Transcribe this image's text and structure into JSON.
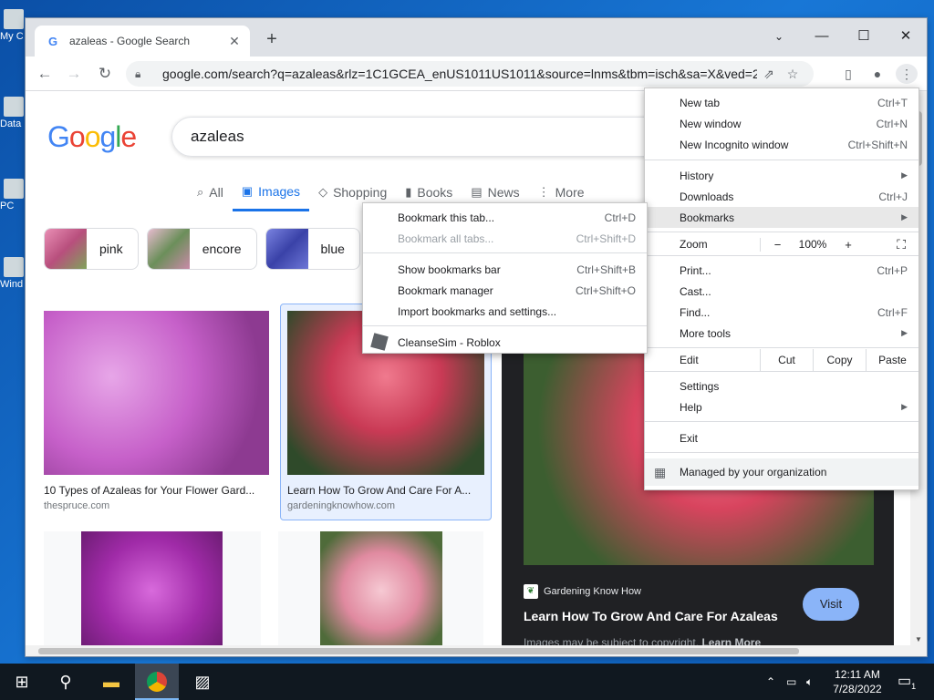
{
  "desktop": {
    "icons": [
      {
        "label": "My C"
      },
      {
        "label": "Data"
      },
      {
        "label": "PC"
      },
      {
        "label": "Wind"
      }
    ]
  },
  "browser": {
    "tab_title": "azaleas - Google Search",
    "tab_favicon": "G",
    "url": "google.com/search?q=azaleas&rlz=1C1GCEA_enUS1011US1011&source=lnms&tbm=isch&sa=X&ved=2a..."
  },
  "page": {
    "logo": "Google",
    "search_query": "azaleas",
    "tabs": [
      {
        "label": "All",
        "icon": "search-icon"
      },
      {
        "label": "Images",
        "icon": "image-icon"
      },
      {
        "label": "Shopping",
        "icon": "tag-icon"
      },
      {
        "label": "Books",
        "icon": "book-icon"
      },
      {
        "label": "News",
        "icon": "news-icon"
      },
      {
        "label": "More",
        "icon": "more-icon"
      }
    ],
    "chips": [
      {
        "label": "pink",
        "color": "#d86a9a"
      },
      {
        "label": "encore",
        "color": "#c98aa8"
      },
      {
        "label": "blue",
        "color": "#5a63c7"
      }
    ],
    "results": [
      {
        "caption": "10 Types of Azaleas for Your Flower Gard...",
        "site": "thespruce.com"
      },
      {
        "caption": "Learn How To Grow And Care For A...",
        "site": "gardeningknowhow.com"
      }
    ],
    "preview": {
      "source": "Gardening Know How",
      "title": "Learn How To Grow And Care For Azaleas",
      "visit": "Visit",
      "copyright": "Images may be subject to copyright.",
      "learn_more": "Learn More"
    }
  },
  "chrome_menu": {
    "new_tab": {
      "label": "New tab",
      "shortcut": "Ctrl+T"
    },
    "new_window": {
      "label": "New window",
      "shortcut": "Ctrl+N"
    },
    "incognito": {
      "label": "New Incognito window",
      "shortcut": "Ctrl+Shift+N"
    },
    "history": {
      "label": "History"
    },
    "downloads": {
      "label": "Downloads",
      "shortcut": "Ctrl+J"
    },
    "bookmarks": {
      "label": "Bookmarks"
    },
    "zoom": {
      "label": "Zoom",
      "minus": "−",
      "value": "100%",
      "plus": "+"
    },
    "print": {
      "label": "Print...",
      "shortcut": "Ctrl+P"
    },
    "cast": {
      "label": "Cast..."
    },
    "find": {
      "label": "Find...",
      "shortcut": "Ctrl+F"
    },
    "more_tools": {
      "label": "More tools"
    },
    "edit": {
      "label": "Edit",
      "cut": "Cut",
      "copy": "Copy",
      "paste": "Paste"
    },
    "settings": {
      "label": "Settings"
    },
    "help": {
      "label": "Help"
    },
    "exit": {
      "label": "Exit"
    },
    "managed": {
      "label": "Managed by your organization"
    }
  },
  "bookmarks_menu": {
    "bookmark_tab": {
      "label": "Bookmark this tab...",
      "shortcut": "Ctrl+D"
    },
    "bookmark_all": {
      "label": "Bookmark all tabs...",
      "shortcut": "Ctrl+Shift+D"
    },
    "show_bar": {
      "label": "Show bookmarks bar",
      "shortcut": "Ctrl+Shift+B"
    },
    "manager": {
      "label": "Bookmark manager",
      "shortcut": "Ctrl+Shift+O"
    },
    "import": {
      "label": "Import bookmarks and settings..."
    },
    "roblox": {
      "label": "CleanseSim - Roblox"
    }
  },
  "taskbar": {
    "time": "12:11 AM",
    "date": "7/28/2022",
    "notification_count": "1"
  }
}
